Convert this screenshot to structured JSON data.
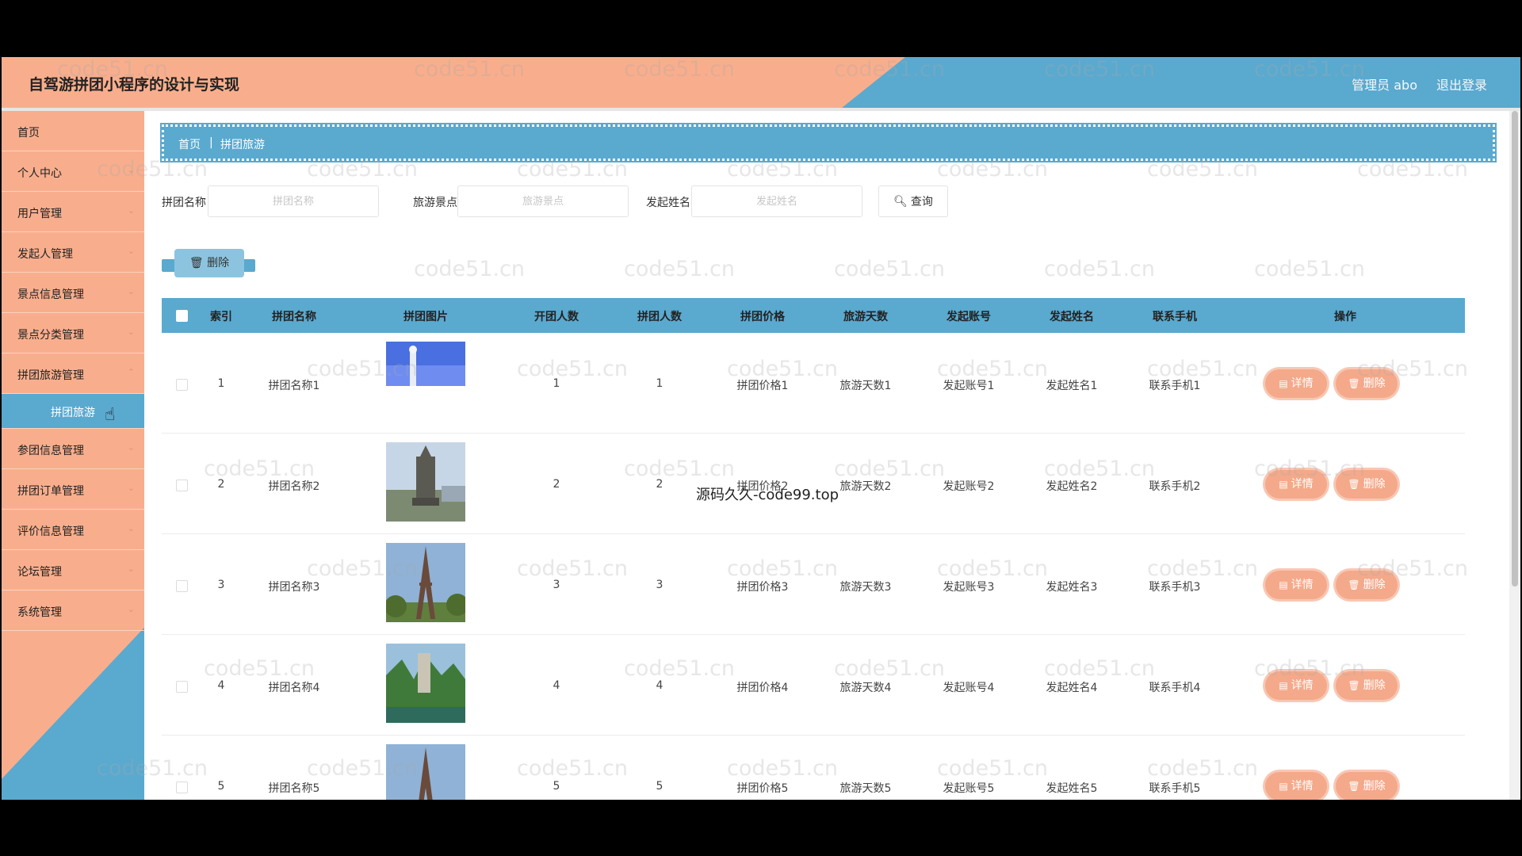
{
  "header": {
    "title": "自驾游拼团小程序的设计与实现",
    "admin": "管理员 abo",
    "logout": "退出登录"
  },
  "sidebar": {
    "items": [
      {
        "label": "首页"
      },
      {
        "label": "个人中心"
      },
      {
        "label": "用户管理"
      },
      {
        "label": "发起人管理"
      },
      {
        "label": "景点信息管理"
      },
      {
        "label": "景点分类管理"
      },
      {
        "label": "拼团旅游管理"
      },
      {
        "label": "拼团旅游"
      },
      {
        "label": "参团信息管理"
      },
      {
        "label": "拼团订单管理"
      },
      {
        "label": "评价信息管理"
      },
      {
        "label": "论坛管理"
      },
      {
        "label": "系统管理"
      }
    ]
  },
  "breadcrumb": {
    "home": "首页",
    "separator": "|",
    "current": "拼团旅游"
  },
  "filters": {
    "name_label": "拼团名称",
    "name_placeholder": "拼团名称",
    "spot_label": "旅游景点",
    "spot_placeholder": "旅游景点",
    "initiator_label": "发起姓名",
    "initiator_placeholder": "发起姓名",
    "query": "查询"
  },
  "batch_delete": "删除",
  "table": {
    "headers": [
      "索引",
      "拼团名称",
      "拼团图片",
      "开团人数",
      "拼团人数",
      "拼团价格",
      "旅游天数",
      "发起账号",
      "发起姓名",
      "联系手机",
      "操作"
    ],
    "detail_label": "详情",
    "delete_label": "删除",
    "rows": [
      {
        "index": "1",
        "name": "拼团名称1",
        "open": "1",
        "count": "1",
        "price": "拼团价格1",
        "days": "旅游天数1",
        "account": "发起账号1",
        "initiator": "发起姓名1",
        "phone": "联系手机1"
      },
      {
        "index": "2",
        "name": "拼团名称2",
        "open": "2",
        "count": "2",
        "price": "拼团价格2",
        "days": "旅游天数2",
        "account": "发起账号2",
        "initiator": "发起姓名2",
        "phone": "联系手机2"
      },
      {
        "index": "3",
        "name": "拼团名称3",
        "open": "3",
        "count": "3",
        "price": "拼团价格3",
        "days": "旅游天数3",
        "account": "发起账号3",
        "initiator": "发起姓名3",
        "phone": "联系手机3"
      },
      {
        "index": "4",
        "name": "拼团名称4",
        "open": "4",
        "count": "4",
        "price": "拼团价格4",
        "days": "旅游天数4",
        "account": "发起账号4",
        "initiator": "发起姓名4",
        "phone": "联系手机4"
      },
      {
        "index": "5",
        "name": "拼团名称5",
        "open": "5",
        "count": "5",
        "price": "拼团价格5",
        "days": "旅游天数5",
        "account": "发起账号5",
        "initiator": "发起姓名5",
        "phone": "联系手机5"
      }
    ]
  },
  "watermark": "code51.cn",
  "source_mark": "源码久久-code99.top",
  "colors": {
    "accent_blue": "#5aa9cf",
    "accent_salmon": "#f8ae8d",
    "button_salmon": "#f4a98a"
  }
}
